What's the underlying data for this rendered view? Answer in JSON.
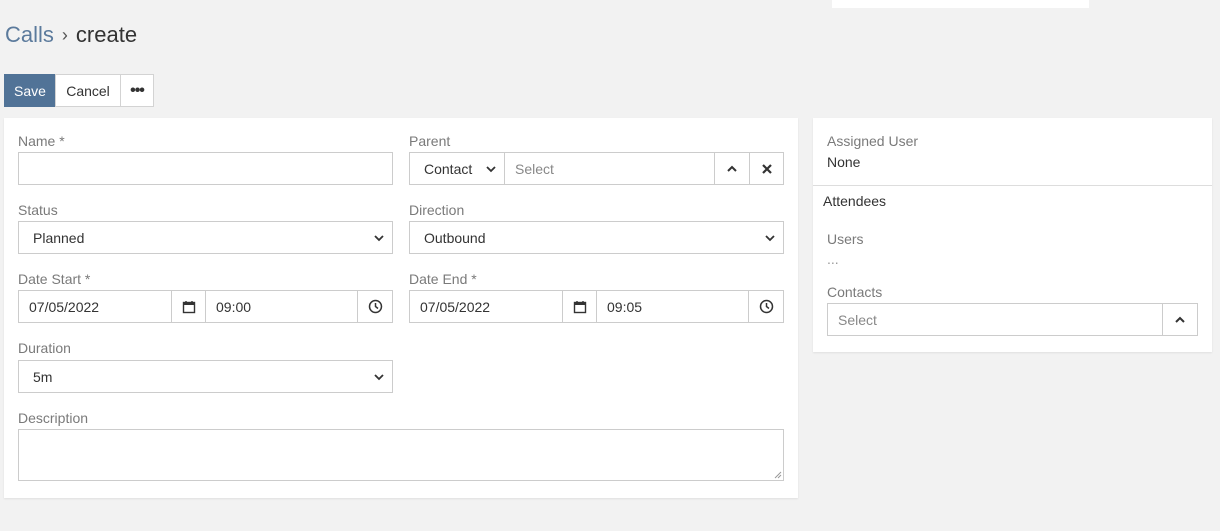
{
  "breadcrumb": {
    "parent": "Calls",
    "separator": "›",
    "current": "create"
  },
  "actions": {
    "save": "Save",
    "cancel": "Cancel",
    "more": "•••"
  },
  "form": {
    "name": {
      "label": "Name *",
      "value": ""
    },
    "parent": {
      "label": "Parent",
      "type_value": "Contact",
      "placeholder": "Select"
    },
    "status": {
      "label": "Status",
      "value": "Planned"
    },
    "direction": {
      "label": "Direction",
      "value": "Outbound"
    },
    "date_start": {
      "label": "Date Start *",
      "date": "07/05/2022",
      "time": "09:00"
    },
    "date_end": {
      "label": "Date End *",
      "date": "07/05/2022",
      "time": "09:05"
    },
    "duration": {
      "label": "Duration",
      "value": "5m"
    },
    "description": {
      "label": "Description",
      "value": ""
    }
  },
  "side": {
    "assigned_user": {
      "label": "Assigned User",
      "value": "None"
    },
    "attendees_heading": "Attendees",
    "users": {
      "label": "Users",
      "value": "..."
    },
    "contacts": {
      "label": "Contacts",
      "placeholder": "Select"
    }
  },
  "colors": {
    "primary": "#517397",
    "link": "#5b7a9c",
    "background": "#f2f2f2"
  }
}
